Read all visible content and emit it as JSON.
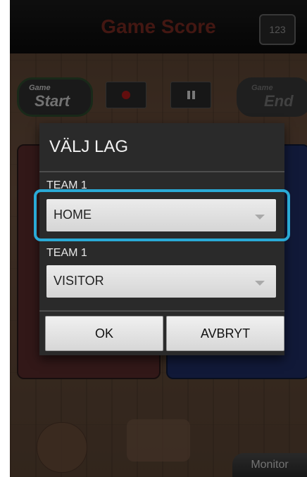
{
  "header": {
    "title": "Game Score",
    "score_icon_label": "123"
  },
  "controls": {
    "game_start_small": "Game",
    "game_start_big": "Start",
    "game_end_small": "Game",
    "game_end_big": "End"
  },
  "footer": {
    "monitor_label": "Monitor"
  },
  "dialog": {
    "title": "VÄLJ LAG",
    "team1_label": "TEAM 1",
    "team1_value": "HOME",
    "team2_label": "TEAM 1",
    "team2_value": "VISITOR",
    "ok_label": "OK",
    "cancel_label": "AVBRYT"
  },
  "colors": {
    "highlight": "#2aaad6",
    "title_red": "#7a2a21",
    "red_panel": "#5b2d2d",
    "blue_panel": "#1f2f66"
  }
}
